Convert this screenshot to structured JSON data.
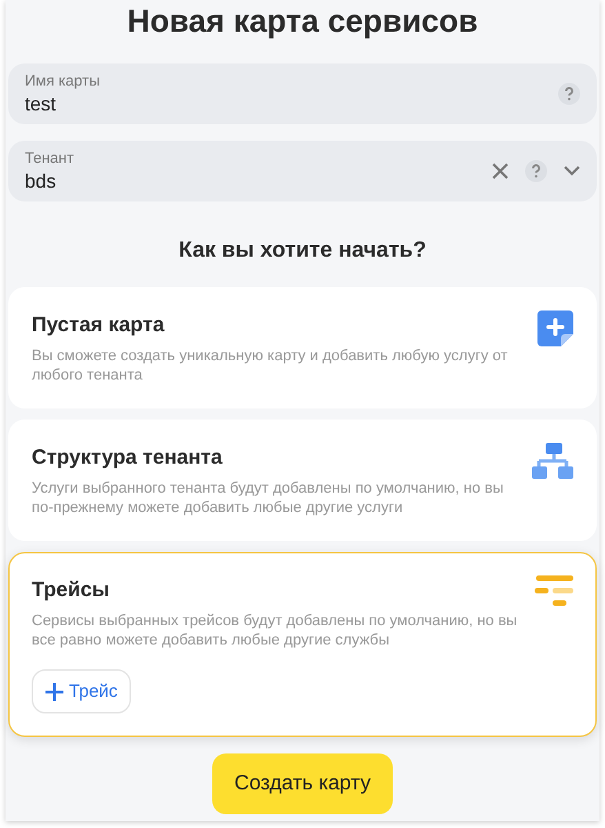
{
  "title": "Новая карта сервисов",
  "fields": [
    {
      "label": "Имя карты",
      "value": "test",
      "clearable": false,
      "dropdown": false
    },
    {
      "label": "Тенант",
      "value": "bds",
      "clearable": true,
      "dropdown": true
    }
  ],
  "question": "Как вы хотите начать?",
  "options": [
    {
      "kind": "empty",
      "title": "Пустая карта",
      "description": "Вы сможете создать уникальную карту и добавить любую услугу от любого тенанта",
      "selected": false
    },
    {
      "kind": "structure",
      "title": "Структура тенанта",
      "description": "Услуги выбранного тенанта будут добавлены по умолчанию, но вы по-прежнему можете добавить любые другие услуги",
      "selected": false
    },
    {
      "kind": "traces",
      "title": "Трейсы",
      "description": "Сервисы выбранных трейсов будут добавлены по умолчанию, но вы все равно можете добавить любые другие службы",
      "selected": true,
      "action": "Трейс"
    }
  ],
  "submit": "Создать карту"
}
